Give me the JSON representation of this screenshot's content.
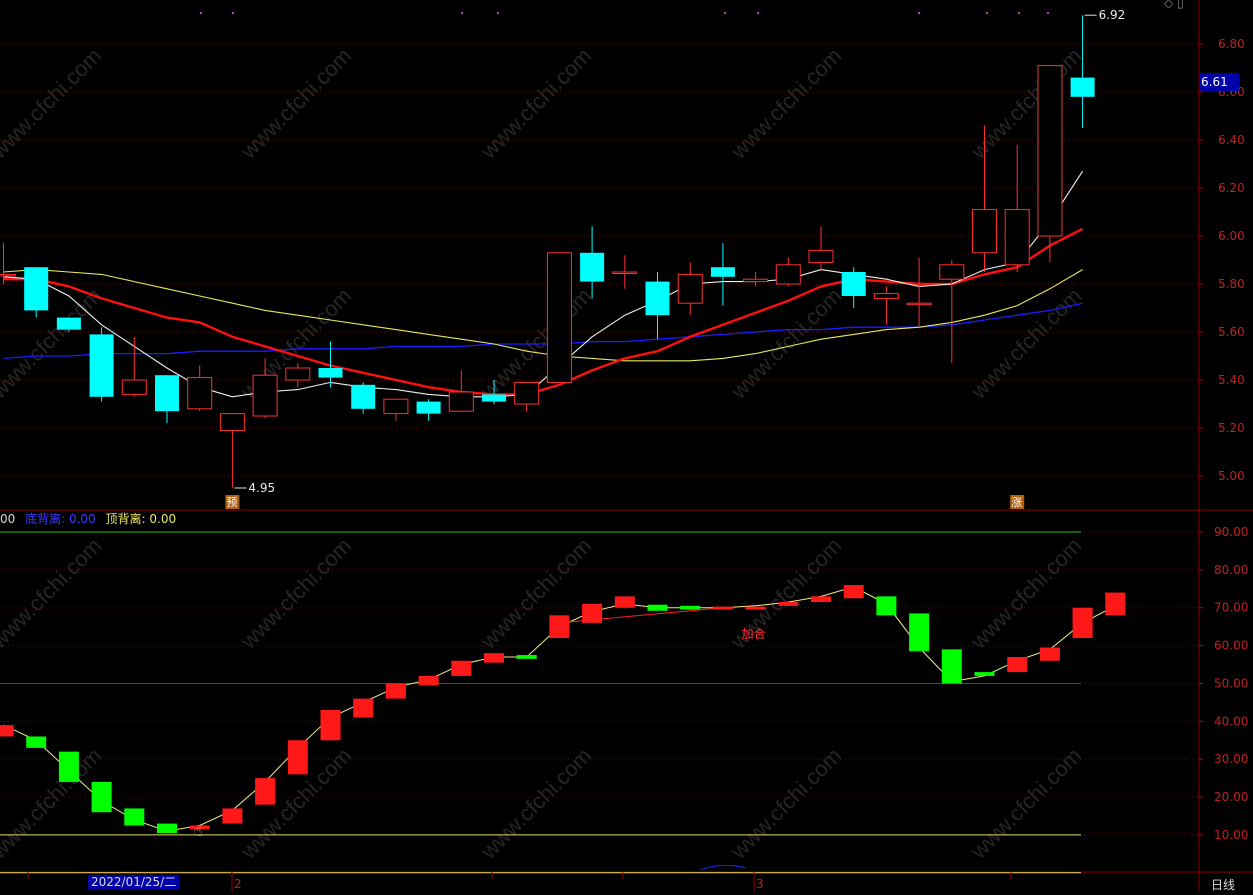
{
  "chart_data": [
    {
      "type": "candlestick",
      "title": "",
      "price_axis": {
        "min": 4.9,
        "max": 6.95,
        "ticks": [
          "6.80",
          "6.60",
          "6.40",
          "6.20",
          "6.00",
          "5.80",
          "5.60",
          "5.40",
          "5.20",
          "5.00"
        ]
      },
      "candles": [
        {
          "o": 5.84,
          "c": 5.84,
          "h": 5.97,
          "l": 5.8,
          "up": true
        },
        {
          "o": 5.87,
          "c": 5.69,
          "h": 5.87,
          "l": 5.66,
          "up": false
        },
        {
          "o": 5.66,
          "c": 5.61,
          "h": 5.66,
          "l": 5.6,
          "up": false
        },
        {
          "o": 5.59,
          "c": 5.33,
          "h": 5.62,
          "l": 5.31,
          "up": false
        },
        {
          "o": 5.34,
          "c": 5.4,
          "h": 5.58,
          "l": 5.33,
          "up": true
        },
        {
          "o": 5.42,
          "c": 5.27,
          "h": 5.42,
          "l": 5.22,
          "up": false
        },
        {
          "o": 5.28,
          "c": 5.41,
          "h": 5.46,
          "l": 5.27,
          "up": true
        },
        {
          "o": 5.19,
          "c": 5.26,
          "h": 5.26,
          "l": 4.95,
          "up": true
        },
        {
          "o": 5.25,
          "c": 5.42,
          "h": 5.49,
          "l": 5.24,
          "up": true
        },
        {
          "o": 5.4,
          "c": 5.45,
          "h": 5.47,
          "l": 5.37,
          "up": true
        },
        {
          "o": 5.45,
          "c": 5.41,
          "h": 5.56,
          "l": 5.37,
          "up": false
        },
        {
          "o": 5.38,
          "c": 5.28,
          "h": 5.39,
          "l": 5.26,
          "up": false
        },
        {
          "o": 5.26,
          "c": 5.32,
          "h": 5.32,
          "l": 5.23,
          "up": true
        },
        {
          "o": 5.31,
          "c": 5.26,
          "h": 5.32,
          "l": 5.23,
          "up": false
        },
        {
          "o": 5.27,
          "c": 5.35,
          "h": 5.44,
          "l": 5.27,
          "up": true
        },
        {
          "o": 5.34,
          "c": 5.31,
          "h": 5.4,
          "l": 5.3,
          "up": false
        },
        {
          "o": 5.3,
          "c": 5.39,
          "h": 5.39,
          "l": 5.27,
          "up": true
        },
        {
          "o": 5.39,
          "c": 5.93,
          "h": 5.93,
          "l": 5.39,
          "up": true
        },
        {
          "o": 5.93,
          "c": 5.81,
          "h": 6.04,
          "l": 5.74,
          "up": false
        },
        {
          "o": 5.85,
          "c": 5.85,
          "h": 5.92,
          "l": 5.78,
          "up": true
        },
        {
          "o": 5.81,
          "c": 5.67,
          "h": 5.85,
          "l": 5.57,
          "up": false
        },
        {
          "o": 5.72,
          "c": 5.84,
          "h": 5.89,
          "l": 5.67,
          "up": true
        },
        {
          "o": 5.87,
          "c": 5.83,
          "h": 5.97,
          "l": 5.71,
          "up": false
        },
        {
          "o": 5.81,
          "c": 5.82,
          "h": 5.85,
          "l": 5.79,
          "up": true
        },
        {
          "o": 5.8,
          "c": 5.88,
          "h": 5.91,
          "l": 5.79,
          "up": true
        },
        {
          "o": 5.89,
          "c": 5.94,
          "h": 6.04,
          "l": 5.86,
          "up": true
        },
        {
          "o": 5.85,
          "c": 5.75,
          "h": 5.87,
          "l": 5.7,
          "up": false
        },
        {
          "o": 5.74,
          "c": 5.76,
          "h": 5.79,
          "l": 5.63,
          "up": true
        },
        {
          "o": 5.72,
          "c": 5.72,
          "h": 5.91,
          "l": 5.62,
          "up": true
        },
        {
          "o": 5.82,
          "c": 5.88,
          "h": 5.9,
          "l": 5.47,
          "up": true
        },
        {
          "o": 5.93,
          "c": 6.11,
          "h": 6.46,
          "l": 5.85,
          "up": true
        },
        {
          "o": 5.88,
          "c": 6.11,
          "h": 6.38,
          "l": 5.85,
          "up": true
        },
        {
          "o": 6.0,
          "c": 6.71,
          "h": 6.71,
          "l": 5.89,
          "up": true
        },
        {
          "o": 6.66,
          "c": 6.58,
          "h": 6.92,
          "l": 6.45,
          "up": false
        }
      ],
      "ma_white": [
        5.83,
        5.82,
        5.75,
        5.63,
        5.54,
        5.45,
        5.37,
        5.33,
        5.35,
        5.36,
        5.39,
        5.37,
        5.36,
        5.34,
        5.33,
        5.33,
        5.34,
        5.46,
        5.58,
        5.67,
        5.73,
        5.8,
        5.81,
        5.81,
        5.82,
        5.86,
        5.84,
        5.82,
        5.79,
        5.8,
        5.86,
        5.89,
        6.06,
        6.27
      ],
      "ma_red": [
        5.82,
        5.82,
        5.79,
        5.74,
        5.7,
        5.66,
        5.64,
        5.58,
        5.54,
        5.5,
        5.46,
        5.43,
        5.4,
        5.37,
        5.35,
        5.34,
        5.34,
        5.38,
        5.44,
        5.49,
        5.52,
        5.58,
        5.63,
        5.68,
        5.73,
        5.79,
        5.82,
        5.81,
        5.8,
        5.8,
        5.84,
        5.87,
        5.96,
        6.03
      ],
      "ma_yellow": [
        5.85,
        5.86,
        5.85,
        5.84,
        5.81,
        5.78,
        5.75,
        5.72,
        5.69,
        5.67,
        5.65,
        5.63,
        5.61,
        5.59,
        5.57,
        5.55,
        5.52,
        5.5,
        5.49,
        5.48,
        5.48,
        5.48,
        5.49,
        5.51,
        5.54,
        5.57,
        5.59,
        5.61,
        5.62,
        5.64,
        5.67,
        5.71,
        5.78,
        5.86
      ],
      "ma_blue": [
        5.49,
        5.5,
        5.5,
        5.51,
        5.51,
        5.51,
        5.52,
        5.52,
        5.52,
        5.53,
        5.53,
        5.53,
        5.54,
        5.54,
        5.54,
        5.55,
        5.55,
        5.55,
        5.56,
        5.56,
        5.57,
        5.58,
        5.59,
        5.6,
        5.61,
        5.61,
        5.62,
        5.62,
        5.62,
        5.63,
        5.65,
        5.67,
        5.69,
        5.72
      ],
      "annotations": [
        {
          "index": 7,
          "value": 4.95,
          "text": "4.95",
          "position": "low"
        },
        {
          "index": 33,
          "value": 6.92,
          "text": "6.92",
          "position": "high"
        }
      ],
      "tags": [
        {
          "index": 7,
          "text": "预"
        },
        {
          "index": 31,
          "text": "涨"
        }
      ],
      "last_price": "6.61"
    },
    {
      "type": "oscillator",
      "title": "",
      "legend": [
        {
          "text": "00",
          "color": "#d8d8d8"
        },
        {
          "text": "底背离: 0.00",
          "color": "#3a3aff"
        },
        {
          "text": "顶背离: 0.00",
          "color": "#e8e868"
        }
      ],
      "axis": {
        "min": 0,
        "max": 98,
        "ticks": [
          "90.00",
          "80.00",
          "70.00",
          "60.00",
          "50.00",
          "40.00",
          "30.00",
          "20.00",
          "10.00"
        ]
      },
      "levels": [
        {
          "value": 90,
          "color": "#20c020"
        },
        {
          "value": 50,
          "color": "#c01818"
        },
        {
          "value": 10,
          "color": "#e0e070"
        },
        {
          "value": 0,
          "color": "#e0e070"
        }
      ],
      "bars": [
        {
          "from": 36,
          "to": 39,
          "up": true
        },
        {
          "from": 36,
          "to": 33,
          "up": false
        },
        {
          "from": 32,
          "to": 24,
          "up": false
        },
        {
          "from": 24,
          "to": 16,
          "up": false
        },
        {
          "from": 17,
          "to": 12.5,
          "up": false
        },
        {
          "from": 13,
          "to": 10.5,
          "up": false
        },
        {
          "from": 11.5,
          "to": 12.5,
          "up": true
        },
        {
          "from": 13,
          "to": 17,
          "up": true
        },
        {
          "from": 18,
          "to": 25,
          "up": true
        },
        {
          "from": 26,
          "to": 35,
          "up": true
        },
        {
          "from": 35,
          "to": 43,
          "up": true
        },
        {
          "from": 41,
          "to": 46,
          "up": true
        },
        {
          "from": 46,
          "to": 50,
          "up": true
        },
        {
          "from": 49.5,
          "to": 52,
          "up": true
        },
        {
          "from": 52,
          "to": 56,
          "up": true
        },
        {
          "from": 55.5,
          "to": 58,
          "up": true
        },
        {
          "from": 57.5,
          "to": 56.5,
          "up": false
        },
        {
          "from": 62,
          "to": 68,
          "up": true
        },
        {
          "from": 66,
          "to": 71,
          "up": true
        },
        {
          "from": 70,
          "to": 73,
          "up": true
        },
        {
          "from": 70.8,
          "to": 69.2,
          "up": false
        },
        {
          "from": 70.5,
          "to": 69.5,
          "up": false
        },
        {
          "from": 70.3,
          "to": 69.5,
          "up": true
        },
        {
          "from": 70.3,
          "to": 69.5,
          "up": true
        },
        {
          "from": 70.5,
          "to": 71.5,
          "up": true
        },
        {
          "from": 71.5,
          "to": 73,
          "up": true
        },
        {
          "from": 72.5,
          "to": 76,
          "up": true
        },
        {
          "from": 73,
          "to": 68,
          "up": false
        },
        {
          "from": 68.5,
          "to": 58.5,
          "up": false
        },
        {
          "from": 59,
          "to": 50,
          "up": false
        },
        {
          "from": 53,
          "to": 52,
          "up": false
        },
        {
          "from": 53,
          "to": 57,
          "up": true
        },
        {
          "from": 56,
          "to": 59.5,
          "up": true
        },
        {
          "from": 62,
          "to": 70,
          "up": true
        },
        {
          "from": 68,
          "to": 74,
          "up": true
        }
      ],
      "k_line": [
        39,
        35,
        27,
        19,
        14,
        11,
        12.5,
        16.5,
        24,
        33,
        41,
        45,
        49,
        51,
        55,
        57,
        57,
        65,
        69,
        71,
        70,
        70,
        70,
        70.5,
        71.5,
        73,
        75.5,
        71,
        59.5,
        50.5,
        52,
        56,
        59,
        66,
        70.5
      ],
      "cross_label": {
        "index": 23,
        "value": 63,
        "text": "加合"
      },
      "watermark": "www.cfchi.com"
    }
  ],
  "price_tag": "6.61",
  "sub_header": {
    "item0": "00",
    "item1": "底背离: 0.00",
    "item2": "顶背离: 0.00"
  },
  "footer": {
    "date": "2022/01/25/二",
    "month_marks": [
      "2",
      "3"
    ],
    "period": "日线"
  },
  "colors": {
    "up": "#ff1818",
    "down_main": "#00ffff",
    "down_sub": "#00ff00",
    "grid": "#6e0000",
    "axis_text": "#c02020"
  },
  "icons": [
    "diamond-icon",
    "window-icon"
  ]
}
